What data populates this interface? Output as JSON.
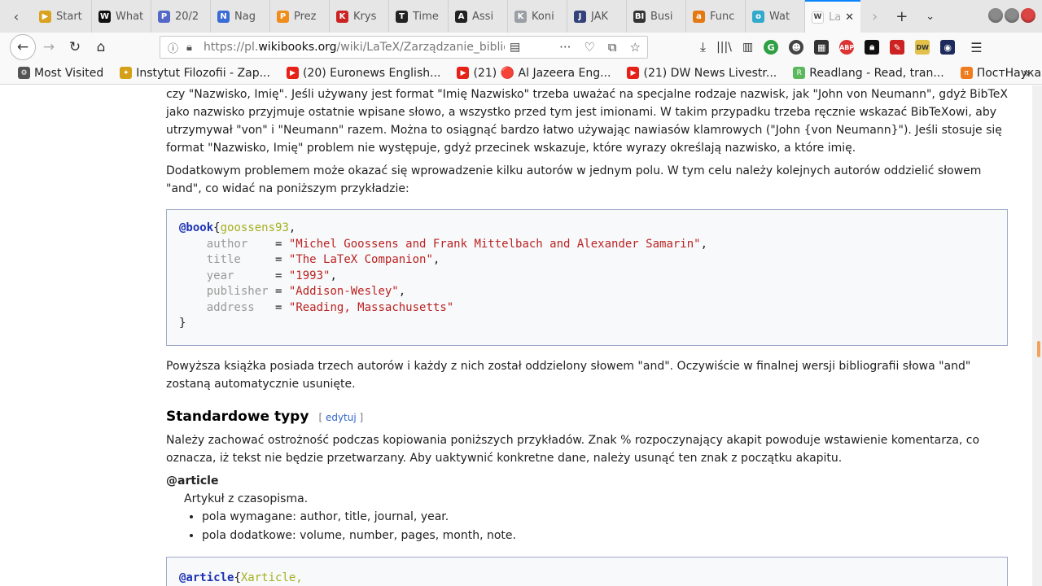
{
  "browser": {
    "tabs": [
      {
        "label": "Start",
        "color": "#d9a21f",
        "glyph": "▶"
      },
      {
        "label": "What",
        "color": "#111111",
        "glyph": "W"
      },
      {
        "label": "20/2",
        "color": "#5468c8",
        "glyph": "P"
      },
      {
        "label": "Nag",
        "color": "#3a6bd6",
        "glyph": "N"
      },
      {
        "label": "Prez",
        "color": "#f08c1a",
        "glyph": "P"
      },
      {
        "label": "Krys",
        "color": "#cc2222",
        "glyph": "K"
      },
      {
        "label": "Time",
        "color": "#222222",
        "glyph": "T"
      },
      {
        "label": "Assi",
        "color": "#222222",
        "glyph": "A"
      },
      {
        "label": "Koni",
        "color": "#9aa0a6",
        "glyph": "K"
      },
      {
        "label": "JAK",
        "color": "#34427a",
        "glyph": "J"
      },
      {
        "label": "Busi",
        "color": "#333333",
        "glyph": "BI"
      },
      {
        "label": "Func",
        "color": "#e47911",
        "glyph": "a"
      },
      {
        "label": "Wat",
        "color": "#33aacc",
        "glyph": "o"
      }
    ],
    "active_tab": {
      "label": "La",
      "color": "#444444",
      "glyph": "W"
    },
    "url": {
      "prefix": "https://pl.",
      "domain": "wikibooks.org",
      "path": "/wiki/LaTeX/Zarządzanie_bibliog"
    },
    "bookmarks": [
      {
        "label": "Most Visited",
        "color": "#555555",
        "glyph": "⚙"
      },
      {
        "label": "Instytut Filozofii - Zap...",
        "color": "#d4a017",
        "glyph": "✦"
      },
      {
        "label": "(20) Euronews English...",
        "color": "#e62117",
        "glyph": "▶"
      },
      {
        "label": "(21) 🔴 Al Jazeera Eng...",
        "color": "#e62117",
        "glyph": "▶"
      },
      {
        "label": "(21) DW News Livestr...",
        "color": "#e62117",
        "glyph": "▶"
      },
      {
        "label": "Readlang - Read, tran...",
        "color": "#5cb85c",
        "glyph": "R"
      },
      {
        "label": "ПостНаука",
        "color": "#f07c1e",
        "glyph": "π"
      }
    ]
  },
  "article": {
    "para1": "czy \"Nazwisko, Imię\". Jeśli używany jest format \"Imię Nazwisko\" trzeba uważać na specjalne rodzaje nazwisk, jak \"John von Neumann\", gdyż BibTeX jako nazwisko przyjmuje ostatnie wpisane słowo, a wszystko przed tym jest imionami. W takim przypadku trzeba ręcznie wskazać BibTeXowi, aby utrzymywał \"von\" i \"Neumann\" razem. Można to osiągnąć bardzo łatwo używając nawiasów klamrowych (\"John {von Neumann}\"). Jeśli stosuje się format \"Nazwisko, Imię\" problem nie występuje, gdyż przecinek wskazuje, które wyrazy określają nazwisko, a które imię.",
    "para2": "Dodatkowym problemem może okazać się wprowadzenie kilku autorów w jednym polu. W tym celu należy kolejnych autorów oddzielić słowem \"and\", co widać na poniższym przykładzie:",
    "code1": {
      "entry_type": "@book",
      "key": "goossens93",
      "fields": [
        {
          "name": "author",
          "value": "\"Michel Goossens and Frank Mittelbach and Alexander Samarin\"",
          "comma": ","
        },
        {
          "name": "title",
          "value": "\"The LaTeX Companion\"",
          "comma": ","
        },
        {
          "name": "year",
          "value": "\"1993\"",
          "comma": ","
        },
        {
          "name": "publisher",
          "value": "\"Addison-Wesley\"",
          "comma": ","
        },
        {
          "name": "address",
          "value": "\"Reading, Massachusetts\"",
          "comma": ""
        }
      ],
      "close": "}"
    },
    "para3": "Powyższa książka posiada trzech autorów i każdy z nich został oddzielony słowem \"and\". Oczywiście w finalnej wersji bibliografii słowa \"and\" zostaną automatycznie usunięte.",
    "section_title": "Standardowe typy",
    "edit_link": "edytuj",
    "para4": "Należy zachować ostrożność podczas kopiowania poniższych przykładów. Znak % rozpoczynający akapit powoduje wstawienie komentarza, co oznacza, iż tekst nie będzie przetwarzany. Aby uaktywnić konkretne dane, należy usunąć ten znak z początku akapitu.",
    "article_type": "@article",
    "article_desc": "Artykuł z czasopisma.",
    "required": "pola wymagane: author, title, journal, year.",
    "optional": "pola dodatkowe: volume, number, pages, month, note.",
    "code2_type": "@article",
    "code2_key": "Xarticle,"
  }
}
